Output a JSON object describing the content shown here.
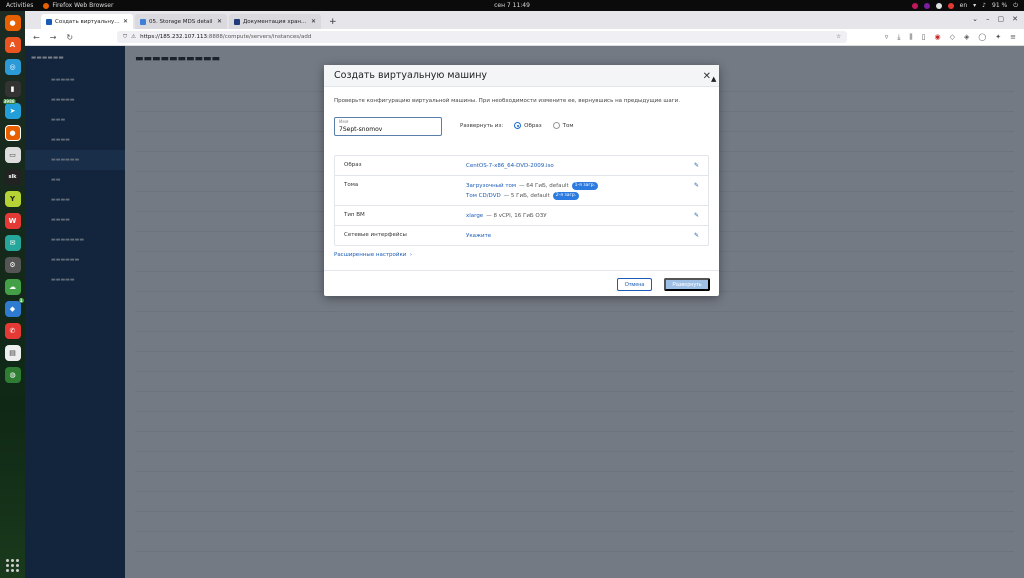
{
  "topbar": {
    "activities": "Activities",
    "app_name": "Firefox Web Browser",
    "clock": "сен 7  11:49",
    "lang": "en",
    "battery": "91 %"
  },
  "dock": {
    "badges": [
      "3988",
      "1"
    ]
  },
  "browser": {
    "tabs": [
      {
        "title": "Создать виртуальную м",
        "active": true
      },
      {
        "title": "05. Storage MDS detail",
        "active": false
      },
      {
        "title": "Документация хранил",
        "active": false
      }
    ],
    "url_host": "https://185.232.107.113",
    "url_path": ":8888/compute/servers/instances/add"
  },
  "modal": {
    "title": "Создать виртуальную машину",
    "description": "Проверьте конфигурацию виртуальной машины. При необходимости измените ее, вернувшись на предыдущие шаги.",
    "name_label": "Имя",
    "name_value": "7Sept-snomov",
    "deploy_label": "Развернуть из:",
    "deploy_options": [
      "Образ",
      "Том"
    ],
    "rows": {
      "image": {
        "key": "Образ",
        "value": "CentOS-7-x86_64-DVD-2009.iso"
      },
      "volumes": {
        "key": "Тома",
        "boot_name": "Загрузочный том",
        "boot_detail": "— 64 ГиБ, default",
        "boot_badge": "1-я загр.",
        "cd_name": "Том CD/DVD",
        "cd_detail": "— 5 ГиБ, default",
        "cd_badge": "2-я загр."
      },
      "flavor": {
        "key": "Тип ВМ",
        "name": "xlarge",
        "detail": "— 8 vCPI, 16 ГиБ ОЗУ"
      },
      "network": {
        "key": "Сетевые интерфейсы",
        "value": "Укажите"
      }
    },
    "advanced_link": "Расширенные настройки",
    "cancel_label": "Отмена",
    "deploy_label_btn": "Развернуть"
  },
  "colors": {
    "accent": "#1a5bb5",
    "badge": "#2d7be0",
    "sidebar": "#1f3b5c"
  }
}
